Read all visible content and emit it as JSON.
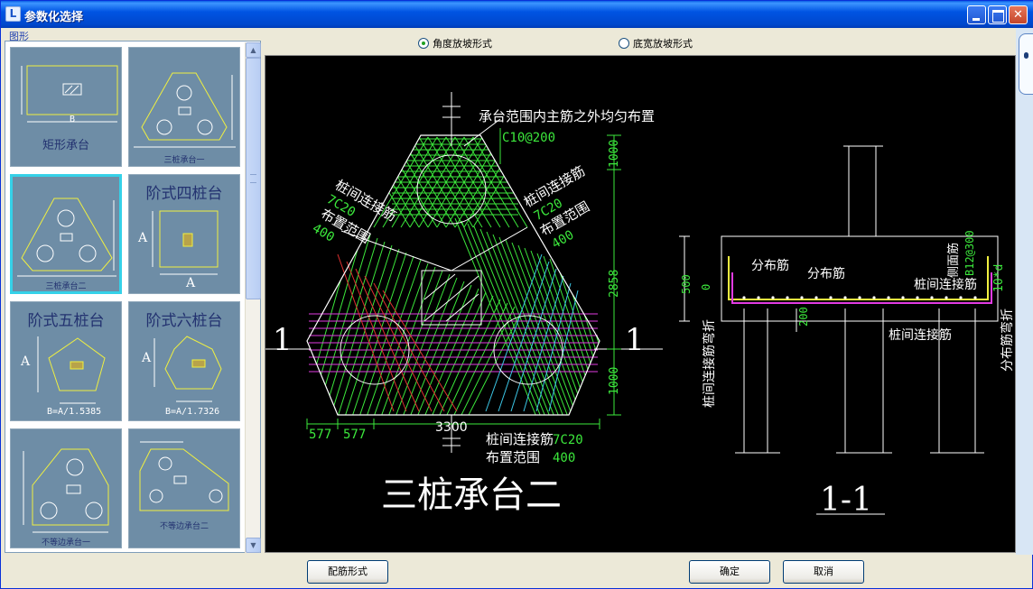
{
  "window": {
    "title": "参数化选择"
  },
  "group": {
    "label": "图形"
  },
  "thumbnails": [
    {
      "caption": "矩形承台",
      "note": "B"
    },
    {
      "caption": "三桩承台一"
    },
    {
      "caption": "三桩承台二",
      "selected": true
    },
    {
      "caption": "阶式四桩台",
      "note1": "A",
      "note2": "A"
    },
    {
      "caption": "阶式五桩台",
      "note1": "A",
      "note2": "B=A/1.5385"
    },
    {
      "caption": "阶式六桩台",
      "note1": "A",
      "note2": "B=A/1.7326"
    },
    {
      "caption": "不等边承台一"
    },
    {
      "caption": "不等边承台二"
    }
  ],
  "options": {
    "angle_label": "角度放坡形式",
    "width_label": "底宽放坡形式",
    "selected": "angle"
  },
  "drawing": {
    "top_note": "承台范围内主筋之外均匀布置",
    "top_spec": "C10@200",
    "left_label1": "桩间连接筋",
    "left_spec1": "7C20",
    "left_label2": "布置范围",
    "left_spec2": "400",
    "right_label1": "桩间连接筋",
    "right_spec1": "7C20",
    "right_label2": "布置范围",
    "right_spec2": "400",
    "dim_top": "1000",
    "dim_mid": "2858",
    "dim_bot": "1000",
    "dim_w1": "577",
    "dim_w2": "577",
    "dim_total": "3300",
    "bottom_label1": "桩间连接筋",
    "bottom_spec1": "7C20",
    "bottom_label2": "布置范围",
    "bottom_spec2": "400",
    "section_mark": "1",
    "plan_title": "三桩承台二",
    "section_title": "1-1",
    "sec_dim_500": "500",
    "sec_dim_0": "0",
    "sec_dim_200": "200",
    "sec_dist1": "分布筋",
    "sec_dist2": "分布筋",
    "sec_side": "侧面筋",
    "sec_side_spec": "B12@300",
    "sec_conn": "桩间连接筋",
    "sec_conn2": "桩间连接筋",
    "sec_left_v": "桩间连接筋弯折",
    "sec_right_v": "分布筋弯折",
    "sec_right_spec": "10*d"
  },
  "buttons": {
    "rebar": "配筋形式",
    "ok": "确定",
    "cancel": "取消"
  },
  "colors": {
    "title_bar": "#0054E3",
    "canvas_bg": "#000000",
    "dim_green": "#3CE83C",
    "rebar_magenta": "#E23BE2",
    "thumb_bg": "#6E8DA6",
    "selected_border": "#35D1E8"
  }
}
